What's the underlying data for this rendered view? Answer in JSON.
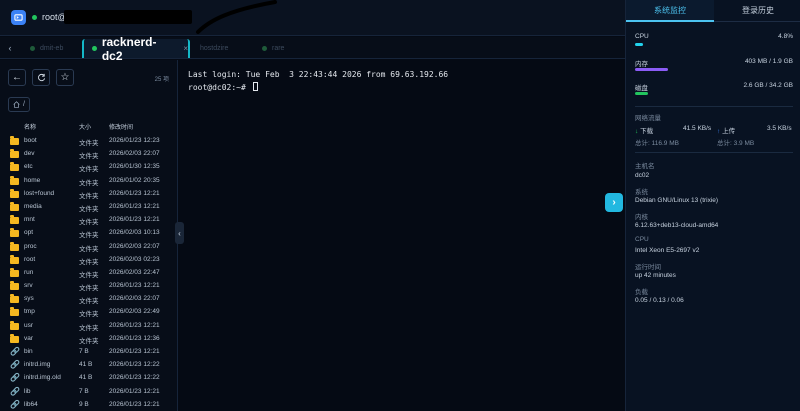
{
  "header": {
    "host_label": "root@7"
  },
  "tabs": {
    "items": [
      {
        "label": "dmit-eb"
      },
      {
        "label": "racknerd-dc2",
        "close": "×"
      },
      {
        "label": "hostdzire"
      },
      {
        "label": "rare"
      }
    ]
  },
  "files": {
    "count": "25 项",
    "path": "/",
    "columns": {
      "name": "名称",
      "size": "大小",
      "time": "修改时间"
    },
    "rows": [
      {
        "name": "boot",
        "size": "文件夹",
        "time": "2026/01/23 12:23",
        "type": "folder"
      },
      {
        "name": "dev",
        "size": "文件夹",
        "time": "2026/02/03 22:07",
        "type": "folder"
      },
      {
        "name": "etc",
        "size": "文件夹",
        "time": "2026/01/30 12:35",
        "type": "folder"
      },
      {
        "name": "home",
        "size": "文件夹",
        "time": "2026/01/02 20:35",
        "type": "folder"
      },
      {
        "name": "lost+found",
        "size": "文件夹",
        "time": "2026/01/23 12:21",
        "type": "folder"
      },
      {
        "name": "media",
        "size": "文件夹",
        "time": "2026/01/23 12:21",
        "type": "folder"
      },
      {
        "name": "mnt",
        "size": "文件夹",
        "time": "2026/01/23 12:21",
        "type": "folder"
      },
      {
        "name": "opt",
        "size": "文件夹",
        "time": "2026/02/03 10:13",
        "type": "folder"
      },
      {
        "name": "proc",
        "size": "文件夹",
        "time": "2026/02/03 22:07",
        "type": "folder"
      },
      {
        "name": "root",
        "size": "文件夹",
        "time": "2026/02/03 02:23",
        "type": "folder"
      },
      {
        "name": "run",
        "size": "文件夹",
        "time": "2026/02/03 22:47",
        "type": "folder"
      },
      {
        "name": "srv",
        "size": "文件夹",
        "time": "2026/01/23 12:21",
        "type": "folder"
      },
      {
        "name": "sys",
        "size": "文件夹",
        "time": "2026/02/03 22:07",
        "type": "folder"
      },
      {
        "name": "tmp",
        "size": "文件夹",
        "time": "2026/02/03 22:49",
        "type": "folder"
      },
      {
        "name": "usr",
        "size": "文件夹",
        "time": "2026/01/23 12:21",
        "type": "folder"
      },
      {
        "name": "var",
        "size": "文件夹",
        "time": "2026/01/23 12:36",
        "type": "folder"
      },
      {
        "name": "bin",
        "size": "7 B",
        "time": "2026/01/23 12:21",
        "type": "link"
      },
      {
        "name": "initrd.img",
        "size": "41 B",
        "time": "2026/01/23 12:22",
        "type": "link"
      },
      {
        "name": "initrd.img.old",
        "size": "41 B",
        "time": "2026/01/23 12:22",
        "type": "link"
      },
      {
        "name": "lib",
        "size": "7 B",
        "time": "2026/01/23 12:21",
        "type": "link"
      },
      {
        "name": "lib64",
        "size": "9 B",
        "time": "2026/01/23 12:21",
        "type": "link"
      }
    ]
  },
  "terminal": {
    "line1": "Last login: Tue Feb  3 22:43:44 2026 from 69.63.192.66",
    "prompt": "root@dc02:~# "
  },
  "monitor": {
    "tab_active": "系统监控",
    "tab_history": "登录历史",
    "cpu": {
      "label": "CPU",
      "value": "4.8%",
      "percent": 4.8,
      "color": "#22d3ee"
    },
    "mem": {
      "label": "内存",
      "value": "403 MB / 1.9 GB",
      "percent": 21,
      "color": "#8b5cf6"
    },
    "disk": {
      "label": "磁盘",
      "value": "2.6 GB / 34.2 GB",
      "percent": 8,
      "color": "#22c55e"
    },
    "net": {
      "title": "网络流量",
      "down_label": "下载",
      "down_rate": "41.5 KB/s",
      "up_label": "上传",
      "up_rate": "3.5 KB/s",
      "total_down": "总计: 116.9 MB",
      "total_up": "总计: 3.9 MB"
    },
    "hostname_label": "主机名",
    "hostname": "dc02",
    "os_label": "系统",
    "os": "Debian GNU/Linux 13 (trixie)",
    "kernel_label": "内核",
    "kernel": "6.12.63+deb13-cloud-amd64",
    "cpu_model_label": "CPU",
    "cpu_model": "Intel Xeon E5-2697 v2",
    "uptime_label": "运行时间",
    "uptime": "up 42 minutes",
    "load_label": "负载",
    "load": "0.05 / 0.13 / 0.06"
  }
}
